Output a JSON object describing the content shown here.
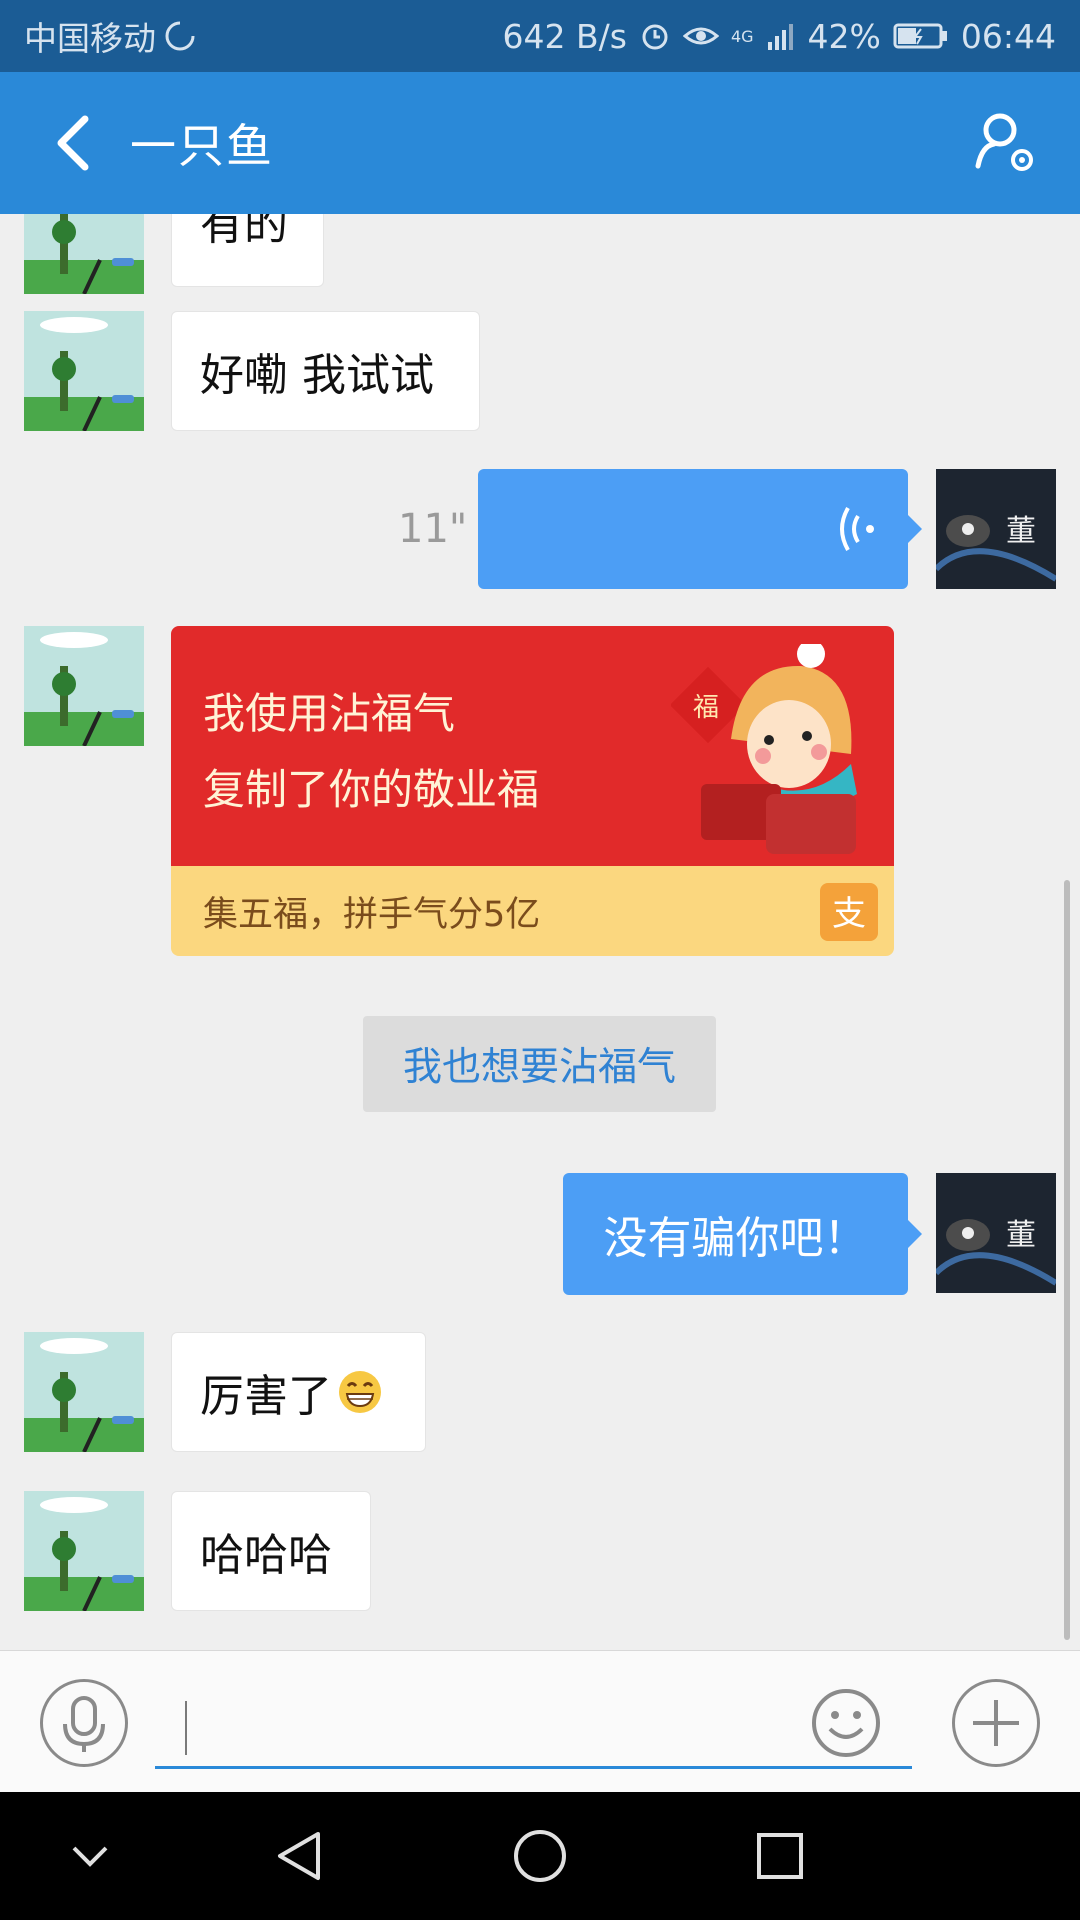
{
  "status_bar": {
    "carrier": "中国移动",
    "net_speed": "642 B/s",
    "network_type": "4G",
    "battery": "42%",
    "time": "06:44"
  },
  "header": {
    "title": "一只鱼",
    "back_icon": "chevron-left-icon",
    "profile_icon": "profile-settings-icon"
  },
  "messages": [
    {
      "from": "friend",
      "text": "有的"
    },
    {
      "from": "friend",
      "text": "好嘞 我试试"
    },
    {
      "from": "me",
      "type": "voice",
      "duration": "11\""
    },
    {
      "from": "friend",
      "type": "card",
      "line1": "我使用沾福气",
      "line2": "复制了你的敬业福",
      "footer": "集五福，拼手气分5亿",
      "fu_char": "福",
      "pay_logo": "支"
    },
    {
      "from": "system",
      "text": "我也想要沾福气"
    },
    {
      "from": "me",
      "text": "没有骗你吧！"
    },
    {
      "from": "friend",
      "text": "厉害了",
      "emoji": "grin-emoji"
    },
    {
      "from": "friend",
      "text": "哈哈哈"
    }
  ],
  "my_avatar_text": "董",
  "input_bar": {
    "mic_icon": "microphone-icon",
    "emoji_icon": "smiley-icon",
    "plus_icon": "plus-icon",
    "value": ""
  },
  "colors": {
    "status_bar": "#1b5c95",
    "title_bar": "#2a89d8",
    "my_bubble": "#4c9ef5",
    "card_red": "#e12a2a",
    "card_yellow": "#fbd77f"
  }
}
